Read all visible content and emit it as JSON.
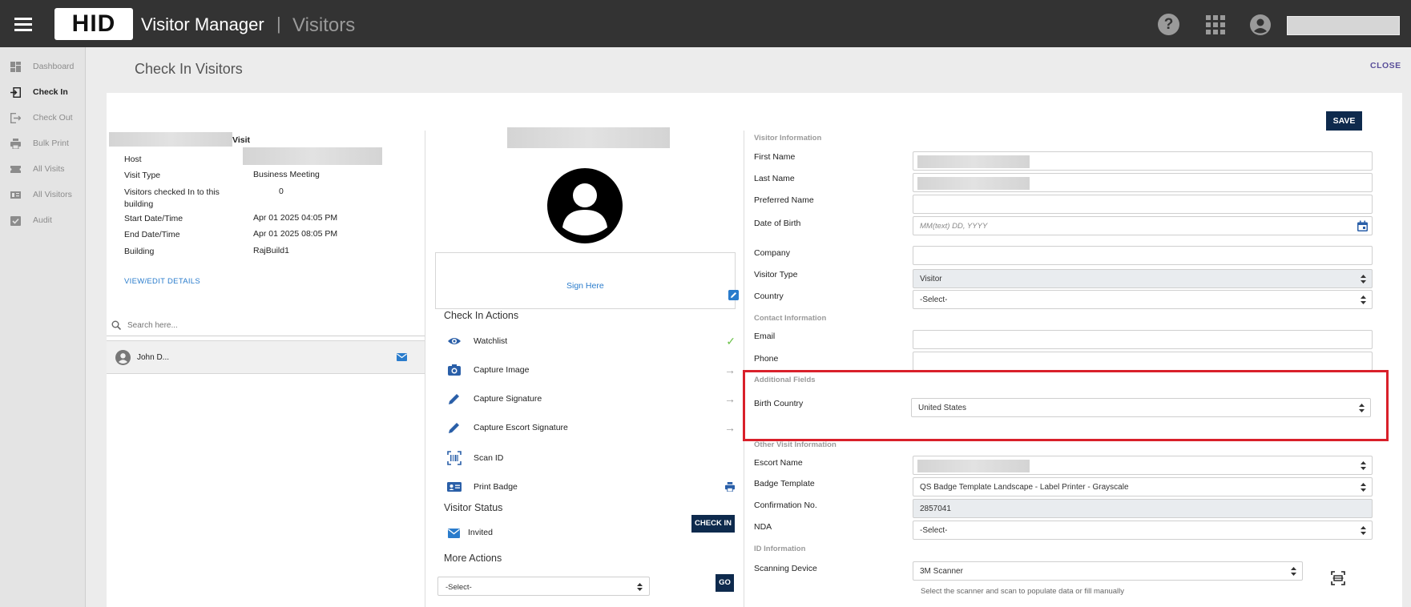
{
  "app": {
    "logo": "HID",
    "title": "Visitor Manager",
    "separator": "|",
    "section": "Visitors"
  },
  "sidebar": {
    "items": [
      {
        "label": "Dashboard"
      },
      {
        "label": "Check In"
      },
      {
        "label": "Check Out"
      },
      {
        "label": "Bulk Print"
      },
      {
        "label": "All Visits"
      },
      {
        "label": "All Visitors"
      },
      {
        "label": "Audit"
      }
    ]
  },
  "page": {
    "title": "Check In Visitors",
    "close": "CLOSE",
    "save": "SAVE"
  },
  "visit": {
    "heading": "Visit",
    "host_label": "Host",
    "visit_type_label": "Visit Type",
    "visit_type": "Business Meeting",
    "checked_in_label": "Visitors checked In to this building",
    "checked_in": "0",
    "start_label": "Start Date/Time",
    "start": "Apr 01 2025 04:05 PM",
    "end_label": "End Date/Time",
    "end": "Apr 01 2025 08:05 PM",
    "building_label": "Building",
    "building": "RajBuild1",
    "view_edit": "VIEW/EDIT DETAILS",
    "search_placeholder": "Search here...",
    "visitor_name": "John D..."
  },
  "middle": {
    "sign_here": "Sign Here",
    "check_in_actions": "Check In Actions",
    "actions": [
      {
        "label": "Watchlist",
        "status": "✓"
      },
      {
        "label": "Capture Image",
        "status": "→"
      },
      {
        "label": "Capture Signature",
        "status": "→"
      },
      {
        "label": "Capture Escort Signature",
        "status": "→"
      },
      {
        "label": "Scan ID",
        "status": ""
      },
      {
        "label": "Print Badge",
        "status": ""
      }
    ],
    "visitor_status_heading": "Visitor Status",
    "visitor_status": "Invited",
    "check_in_button": "CHECK IN",
    "more_actions_heading": "More Actions",
    "more_actions_value": "-Select-",
    "go_button": "GO"
  },
  "form": {
    "visitor_info_heading": "Visitor Information",
    "first_name_label": "First Name",
    "last_name_label": "Last Name",
    "preferred_name_label": "Preferred Name",
    "dob_label": "Date of Birth",
    "dob_placeholder": "MM(text) DD, YYYY",
    "company_label": "Company",
    "visitor_type_label": "Visitor Type",
    "visitor_type": "Visitor",
    "country_label": "Country",
    "country": "-Select-",
    "contact_heading": "Contact Information",
    "email_label": "Email",
    "phone_label": "Phone",
    "additional_heading": "Additional Fields",
    "birth_country_label": "Birth Country",
    "birth_country": "United States",
    "other_visit_heading": "Other Visit Information",
    "escort_label": "Escort Name",
    "badge_template_label": "Badge Template",
    "badge_template": "QS Badge Template Landscape - Label Printer - Grayscale",
    "confirmation_label": "Confirmation No.",
    "confirmation": "2857041",
    "nda_label": "NDA",
    "nda": "-Select-",
    "id_heading": "ID Information",
    "scanning_label": "Scanning Device",
    "scanning_device": "3M Scanner",
    "scanning_hint": "Select the scanner and scan to populate data or fill manually"
  },
  "colors": {
    "topbar": "#333333",
    "primary_button": "#0e2a4d",
    "link": "#2a7ccc",
    "highlight": "#d9202a"
  }
}
